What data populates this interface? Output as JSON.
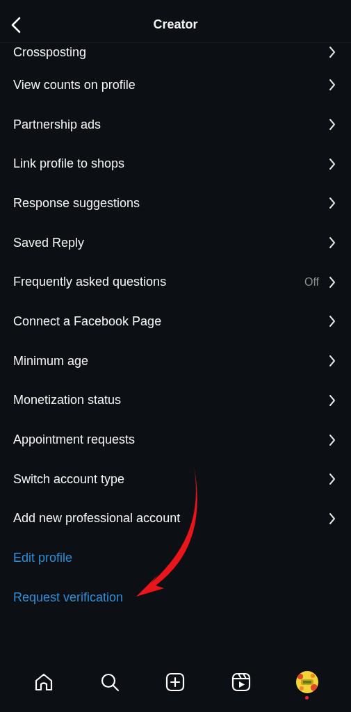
{
  "header": {
    "title": "Creator"
  },
  "items": [
    {
      "kind": "nav",
      "label": "Crossposting"
    },
    {
      "kind": "nav",
      "label": "View counts on profile"
    },
    {
      "kind": "nav",
      "label": "Partnership ads"
    },
    {
      "kind": "nav",
      "label": "Link profile to shops"
    },
    {
      "kind": "nav",
      "label": "Response suggestions"
    },
    {
      "kind": "nav",
      "label": "Saved Reply"
    },
    {
      "kind": "nav",
      "label": "Frequently asked questions",
      "value": "Off"
    },
    {
      "kind": "nav",
      "label": "Connect a Facebook Page"
    },
    {
      "kind": "nav",
      "label": "Minimum age"
    },
    {
      "kind": "nav",
      "label": "Monetization status"
    },
    {
      "kind": "nav",
      "label": "Appointment requests"
    },
    {
      "kind": "nav",
      "label": "Switch account type"
    },
    {
      "kind": "nav",
      "label": "Add new professional account"
    },
    {
      "kind": "link",
      "label": "Edit profile"
    },
    {
      "kind": "link",
      "label": "Request verification"
    }
  ],
  "tab_bar": [
    {
      "kind": "home",
      "notification": false
    },
    {
      "kind": "search",
      "notification": false
    },
    {
      "kind": "create",
      "notification": false
    },
    {
      "kind": "reels",
      "notification": false
    },
    {
      "kind": "profile",
      "notification": true
    }
  ]
}
